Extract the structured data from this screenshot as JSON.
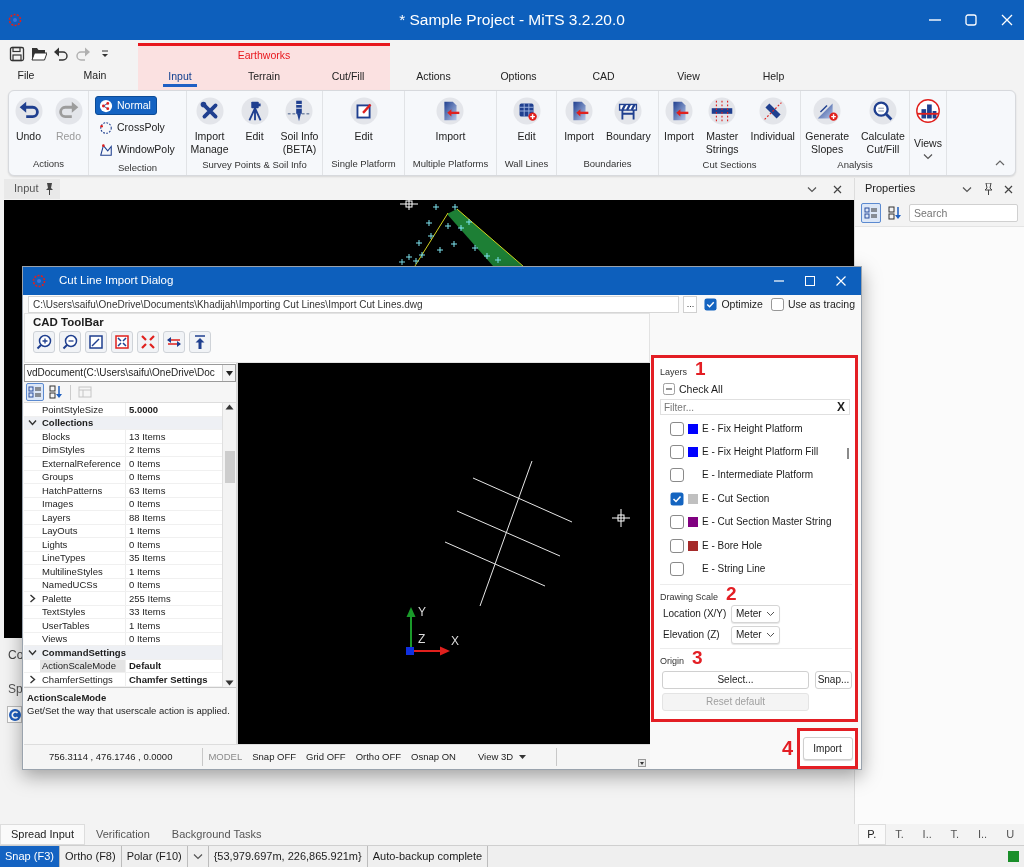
{
  "window": {
    "title": "* Sample Project - MiTS 3.2.20.0"
  },
  "quick_access": [
    {
      "kind": "save",
      "disabled": false
    },
    {
      "kind": "open",
      "disabled": false
    },
    {
      "kind": "undo",
      "disabled": false
    },
    {
      "kind": "redo",
      "disabled": true
    },
    {
      "kind": "customize",
      "disabled": false
    }
  ],
  "ribbon_tabs": [
    {
      "kind": "tab",
      "label": "File",
      "selected": false
    },
    {
      "kind": "tab",
      "label": "Main",
      "selected": false
    },
    {
      "kind": "context",
      "label": "Earthworks",
      "tabs": [
        {
          "label": "Input",
          "selected": true
        },
        {
          "label": "Terrain",
          "selected": false
        },
        {
          "label": "Cut/Fill",
          "selected": false
        }
      ]
    },
    {
      "kind": "tab",
      "label": "Actions",
      "selected": false
    },
    {
      "kind": "tab",
      "label": "Options",
      "selected": false
    },
    {
      "kind": "tab",
      "label": "CAD",
      "selected": false
    },
    {
      "kind": "tab",
      "label": "View",
      "selected": false
    },
    {
      "kind": "tab",
      "label": "Help",
      "selected": false
    }
  ],
  "ribbon_groups": [
    {
      "label": "Actions",
      "kind": "large",
      "buttons": [
        {
          "kind": "undo",
          "label": "Undo",
          "disabled": false
        },
        {
          "kind": "redo",
          "label": "Redo",
          "disabled": true
        }
      ]
    },
    {
      "label": "Selection",
      "kind": "stack",
      "buttons": [
        {
          "kind": "normal",
          "label": "Normal",
          "selected": true
        },
        {
          "kind": "crosspoly",
          "label": "CrossPoly",
          "selected": false
        },
        {
          "kind": "windowpoly",
          "label": "WindowPoly",
          "selected": false
        }
      ]
    },
    {
      "label": "Survey Points & Soil Info",
      "kind": "large",
      "buttons": [
        {
          "kind": "tools",
          "label": "Import\nManage",
          "disabled": false
        },
        {
          "kind": "tripod",
          "label": "Edit",
          "disabled": false
        },
        {
          "kind": "drill",
          "label": "Soil Info\n(BETA)",
          "disabled": false
        }
      ]
    },
    {
      "label": "Single Platform",
      "kind": "large",
      "buttons": [
        {
          "kind": "edit",
          "label": "Edit",
          "disabled": false
        }
      ]
    },
    {
      "label": "Multiple Platforms",
      "kind": "large",
      "buttons": [
        {
          "kind": "import",
          "label": "Import",
          "disabled": false
        }
      ]
    },
    {
      "label": "Wall Lines",
      "kind": "large",
      "buttons": [
        {
          "kind": "wall",
          "label": "Edit",
          "disabled": false
        }
      ]
    },
    {
      "label": "Boundaries",
      "kind": "large",
      "buttons": [
        {
          "kind": "import",
          "label": "Import",
          "disabled": false
        },
        {
          "kind": "barrier",
          "label": "Boundary",
          "disabled": false
        }
      ]
    },
    {
      "label": "Cut Sections",
      "kind": "large",
      "buttons": [
        {
          "kind": "import",
          "label": "Import",
          "disabled": false
        },
        {
          "kind": "strings",
          "label": "Master\nStrings",
          "disabled": false
        },
        {
          "kind": "individual",
          "label": "Individual",
          "disabled": false
        }
      ]
    },
    {
      "label": "Analysis",
      "kind": "large",
      "buttons": [
        {
          "kind": "slopes",
          "label": "Generate\nSlopes",
          "disabled": false
        },
        {
          "kind": "calculate",
          "label": "Calculate\nCut/Fill",
          "disabled": false
        }
      ]
    },
    {
      "kind": "dropdown",
      "buttons": [
        {
          "kind": "views",
          "label": "Views",
          "disabled": false
        }
      ]
    }
  ],
  "document_tab": {
    "label": "Input"
  },
  "lower_panel": {
    "header": "Co",
    "label": "Sp"
  },
  "properties_panel": {
    "title": "Properties",
    "view_buttons": [
      {
        "kind": "categorized",
        "selected": true
      },
      {
        "kind": "alphabetical",
        "selected": false
      }
    ],
    "search": {
      "placeholder": "Search"
    },
    "tabs": [
      {
        "label": "P.",
        "selected": true
      },
      {
        "label": "T.",
        "selected": false
      },
      {
        "label": "I..",
        "selected": false
      },
      {
        "label": "T.",
        "selected": false
      },
      {
        "label": "I..",
        "selected": false
      },
      {
        "label": "U",
        "selected": false
      }
    ]
  },
  "bottom_tabs": [
    {
      "label": "Spread Input",
      "selected": true
    },
    {
      "label": "Verification",
      "selected": false
    },
    {
      "label": "Background Tasks",
      "selected": false
    }
  ],
  "status_bar": {
    "toggles": [
      {
        "label": "Snap (F3)",
        "on": true
      },
      {
        "label": "Ortho (F8)",
        "on": false
      },
      {
        "label": "Polar (F10)",
        "on": false
      }
    ],
    "coordinates": "{53,979.697m, 226,865.921m}",
    "message": "Auto-backup complete"
  },
  "dialog": {
    "title": "Cut Line Import Dialog",
    "path": "C:\\Users\\saifu\\OneDrive\\Documents\\Khadijah\\Importing Cut Lines\\Import Cut Lines.dwg",
    "browse_label": "...",
    "options": [
      {
        "label": "Optimize",
        "checked": true
      },
      {
        "label": "Use as tracing",
        "checked": false
      }
    ],
    "toolbar": {
      "title": "CAD ToolBar",
      "buttons": [
        {
          "kind": "zoomin"
        },
        {
          "kind": "zoomout"
        },
        {
          "kind": "zoomwindow"
        },
        {
          "kind": "extents"
        },
        {
          "kind": "shrink"
        },
        {
          "kind": "stretch"
        },
        {
          "kind": "upload"
        }
      ]
    },
    "property_grid": {
      "document": "vdDocument(C:\\Users\\saifu\\OneDrive\\Doc",
      "view_buttons": [
        {
          "kind": "categorized",
          "selected": true,
          "disabled": false
        },
        {
          "kind": "alphabetical",
          "selected": false,
          "disabled": false
        },
        {
          "kind": "pages",
          "selected": false,
          "disabled": true
        }
      ],
      "rows": [
        {
          "kind": "property",
          "name": "PointStyleSize",
          "value": "5.0000",
          "modified": true,
          "selected": false
        },
        {
          "kind": "category",
          "name": "Collections",
          "expanded": true,
          "selected": false
        },
        {
          "kind": "property",
          "name": "Blocks",
          "value": "13 Items",
          "modified": false,
          "selected": false
        },
        {
          "kind": "property",
          "name": "DimStyles",
          "value": "2 Items",
          "modified": false,
          "selected": false
        },
        {
          "kind": "property",
          "name": "ExternalReference",
          "value": "0 Items",
          "modified": false,
          "selected": false
        },
        {
          "kind": "property",
          "name": "Groups",
          "value": "0 Items",
          "modified": false,
          "selected": false
        },
        {
          "kind": "property",
          "name": "HatchPatterns",
          "value": "63 Items",
          "modified": false,
          "selected": false
        },
        {
          "kind": "property",
          "name": "Images",
          "value": "0 Items",
          "modified": false,
          "selected": false
        },
        {
          "kind": "property",
          "name": "Layers",
          "value": "88 Items",
          "modified": false,
          "selected": false
        },
        {
          "kind": "property",
          "name": "LayOuts",
          "value": "1 Items",
          "modified": false,
          "selected": false
        },
        {
          "kind": "property",
          "name": "Lights",
          "value": "0 Items",
          "modified": false,
          "selected": false
        },
        {
          "kind": "property",
          "name": "LineTypes",
          "value": "35 Items",
          "modified": false,
          "selected": false
        },
        {
          "kind": "property",
          "name": "MultilineStyles",
          "value": "1 Items",
          "modified": false,
          "selected": false
        },
        {
          "kind": "property",
          "name": "NamedUCSs",
          "value": "0 Items",
          "modified": false,
          "selected": false
        },
        {
          "kind": "expandable",
          "name": "Palette",
          "value": "255 Items",
          "modified": false,
          "expanded": false,
          "selected": false
        },
        {
          "kind": "property",
          "name": "TextStyles",
          "value": "33 Items",
          "modified": false,
          "selected": false
        },
        {
          "kind": "property",
          "name": "UserTables",
          "value": "1 Items",
          "modified": false,
          "selected": false
        },
        {
          "kind": "property",
          "name": "Views",
          "value": "0 Items",
          "modified": false,
          "selected": false
        },
        {
          "kind": "category",
          "name": "CommandSettings",
          "expanded": true,
          "selected": false
        },
        {
          "kind": "property",
          "name": "ActionScaleMode",
          "value": "Default",
          "modified": true,
          "selected": true
        },
        {
          "kind": "expandable",
          "name": "ChamferSettings",
          "value": "Chamfer Settings",
          "modified": true,
          "expanded": false,
          "selected": false
        }
      ],
      "description": {
        "title": "ActionScaleMode",
        "text": "Get/Set the way that userscale action is applied."
      }
    },
    "canvas": {
      "axis_labels": [
        "Y",
        "Z",
        "X"
      ]
    },
    "cad_status": {
      "coordinates": "756.3114 , 476.1746 , 0.0000",
      "mode": "MODEL",
      "toggles": [
        "Snap OFF",
        "Grid OFF",
        "Ortho OFF",
        "Osnap ON"
      ],
      "view": "View 3D"
    },
    "layers": {
      "title": "Layers",
      "marker": "1",
      "check_all": {
        "label": "Check All",
        "indeterminate": true
      },
      "filter": {
        "placeholder": "Filter...",
        "clear": "X"
      },
      "items": [
        {
          "label": "E - Fix Height Platform",
          "checked": false,
          "color": "#0000ff"
        },
        {
          "label": "E - Fix Height Platform Fill",
          "checked": false,
          "color": "#0000ff"
        },
        {
          "label": "E - Intermediate Platform",
          "checked": false
        },
        {
          "label": "E - Cut Section",
          "checked": true,
          "color": "#c0c0c0"
        },
        {
          "label": "E - Cut Section Master String",
          "checked": false,
          "color": "#800080"
        },
        {
          "label": "E - Bore Hole",
          "checked": false,
          "color": "#a52a2a"
        },
        {
          "label": "E - String Line",
          "checked": false
        }
      ]
    },
    "drawing_scale": {
      "title": "Drawing Scale",
      "marker": "2",
      "fields": [
        {
          "label": "Location (X/Y)",
          "value": "Meter"
        },
        {
          "label": "Elevation (Z)",
          "value": "Meter"
        }
      ]
    },
    "origin": {
      "title": "Origin",
      "marker": "3",
      "button_rows": [
        [
          {
            "label": "Select...",
            "disabled": false
          },
          {
            "label": "Snap...",
            "disabled": false
          }
        ],
        [
          {
            "label": "Reset default",
            "disabled": true
          }
        ]
      ]
    },
    "import_button": {
      "label": "Import",
      "marker": "4"
    }
  }
}
